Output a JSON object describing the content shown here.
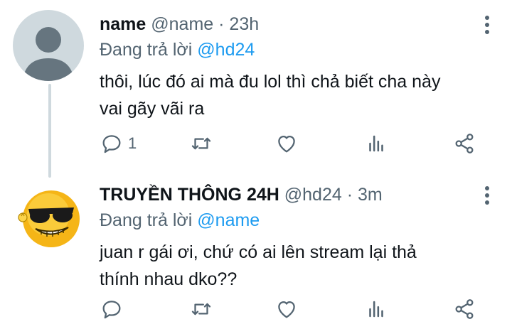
{
  "tweets": [
    {
      "name": "name",
      "handle": "@name",
      "dot": "·",
      "time": "23h",
      "replying_prefix": "Đang trả lời",
      "replying_to": "@hd24",
      "text_line1": "thôi, lúc đó ai mà đu lol thì chả biết cha này",
      "text_line2": "vai gãy vãi ra",
      "reply_count": "1",
      "avatar": "default-profile-icon"
    },
    {
      "name": "TRUYỀN THÔNG 24H",
      "handle": "@hd24",
      "dot": "·",
      "time": "3m",
      "replying_prefix": "Đang trả lời",
      "replying_to": "@name",
      "text_line1": "juan r gái ơi, chứ có ai lên stream lại thả",
      "text_line2": "thính nhau dko??",
      "reply_count": "",
      "avatar": "sunglasses-emoji-icon"
    }
  ],
  "colors": {
    "accent": "#1d9bf0",
    "secondary_text": "#536471",
    "primary_text": "#0f1419",
    "thread_line": "#cfd9de"
  },
  "icons": [
    "reply-icon",
    "retweet-icon",
    "like-icon",
    "views-icon",
    "share-icon",
    "more-options-icon"
  ]
}
